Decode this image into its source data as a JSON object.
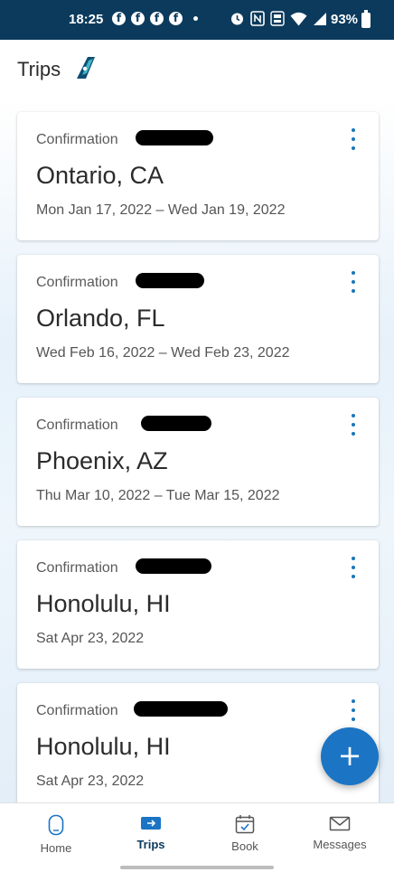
{
  "status_bar": {
    "time": "18:25",
    "notification_icons": [
      "facebook-icon",
      "facebook-icon",
      "facebook-icon",
      "facebook-icon"
    ],
    "system_icons": [
      "alarm-icon",
      "nfc-icon",
      "vowifi-icon",
      "wifi-icon",
      "signal-icon"
    ],
    "battery": "93%"
  },
  "header": {
    "title": "Trips",
    "icon": "airplane-tail-icon"
  },
  "trips": [
    {
      "confirmation_label": "Confirmation",
      "city": "Ontario, CA",
      "dates": "Mon Jan 17, 2022 – Wed Jan 19, 2022"
    },
    {
      "confirmation_label": "Confirmation",
      "city": "Orlando, FL",
      "dates": "Wed Feb 16, 2022 – Wed Feb 23, 2022"
    },
    {
      "confirmation_label": "Confirmation",
      "city": "Phoenix, AZ",
      "dates": "Thu Mar 10, 2022 – Tue Mar 15, 2022"
    },
    {
      "confirmation_label": "Confirmation",
      "city": "Honolulu, HI",
      "dates": "Sat Apr 23, 2022"
    },
    {
      "confirmation_label": "Confirmation",
      "city": "Honolulu, HI",
      "dates": "Sat Apr 23, 2022"
    }
  ],
  "fab": {
    "label": "+"
  },
  "bottom_nav": {
    "items": [
      {
        "label": "Home",
        "icon": "home-icon",
        "active": false
      },
      {
        "label": "Trips",
        "icon": "boarding-pass-icon",
        "active": true
      },
      {
        "label": "Book",
        "icon": "calendar-check-icon",
        "active": false
      },
      {
        "label": "Messages",
        "icon": "envelope-icon",
        "active": false
      }
    ]
  },
  "colors": {
    "status_bar": "#0b3a5c",
    "accent": "#1b74c4",
    "active_nav": "#0b3a5c"
  }
}
